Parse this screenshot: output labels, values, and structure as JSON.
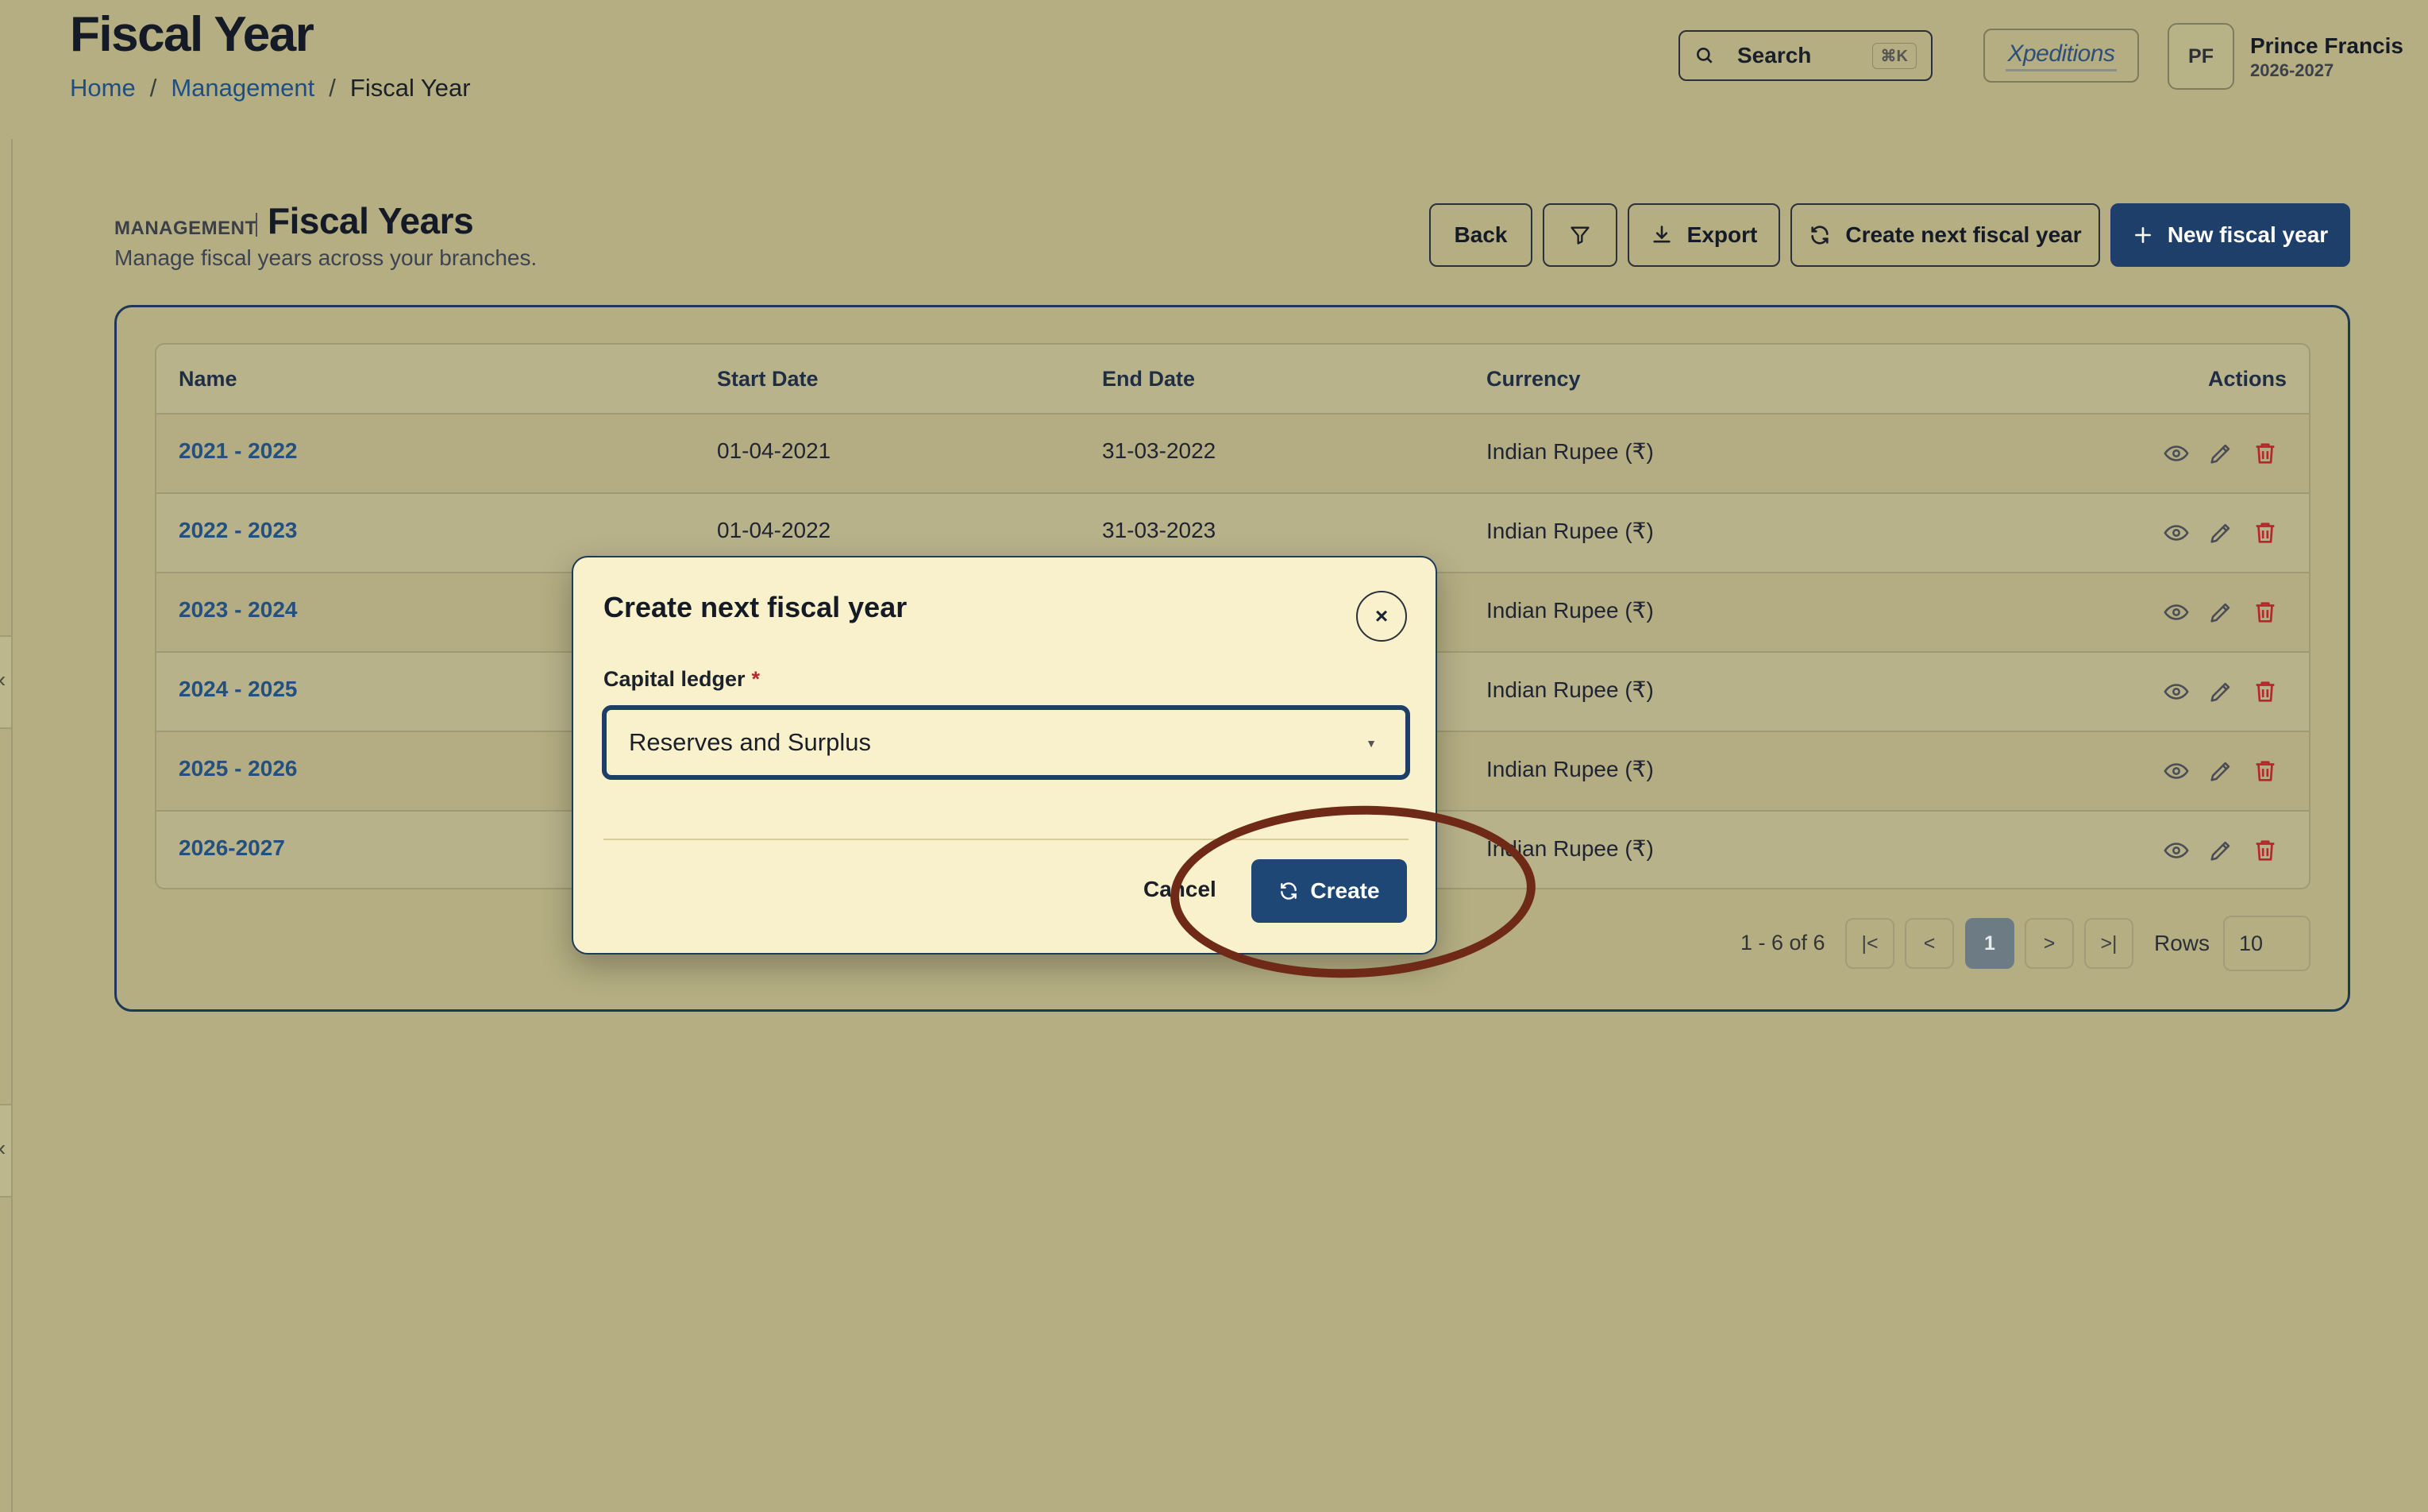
{
  "header": {
    "title": "Fiscal Year",
    "breadcrumb": [
      "Home",
      "Management",
      "Fiscal Year"
    ],
    "breadcrumb_sep": "/",
    "search_label": "Search",
    "search_shortcut": "⌘K",
    "logo_text": "Xpeditions",
    "user": {
      "initials": "PF",
      "name": "Prince Francis",
      "year": "2026-2027"
    }
  },
  "section": {
    "kicker": "MANAGEMENT",
    "title": "Fiscal Years",
    "subtitle": "Manage fiscal years across your branches."
  },
  "toolbar": {
    "back": "Back",
    "filter_icon": "filter-icon",
    "export": "Export",
    "create_next": "Create next fiscal year",
    "new": "New fiscal year"
  },
  "table": {
    "columns": [
      "Name",
      "Start Date",
      "End Date",
      "Currency",
      "Actions"
    ],
    "rows": [
      {
        "name": "2021 - 2022",
        "start": "01-04-2021",
        "end": "31-03-2022",
        "currency": "Indian Rupee (₹)"
      },
      {
        "name": "2022 - 2023",
        "start": "01-04-2022",
        "end": "31-03-2023",
        "currency": "Indian Rupee (₹)"
      },
      {
        "name": "2023 - 2024",
        "start": "",
        "end": "",
        "currency": "Indian Rupee (₹)"
      },
      {
        "name": "2024 - 2025",
        "start": "",
        "end": "",
        "currency": "Indian Rupee (₹)"
      },
      {
        "name": "2025 - 2026",
        "start": "",
        "end": "",
        "currency": "Indian Rupee (₹)"
      },
      {
        "name": "2026-2027",
        "start": "",
        "end": "",
        "currency": "Indian Rupee (₹)"
      }
    ]
  },
  "pagination": {
    "summary": "1 - 6 of 6",
    "first": "|<",
    "prev": "<",
    "current": "1",
    "next": ">",
    "last": ">|",
    "rows_label": "Rows",
    "rows_value": "10"
  },
  "modal": {
    "title": "Create next fiscal year",
    "close": "×",
    "field_label": "Capital ledger",
    "required_mark": "*",
    "field_value": "Reserves and Surplus",
    "cancel": "Cancel",
    "create": "Create"
  },
  "colors": {
    "background": "#b4ae82",
    "primary": "#1f3f6b",
    "link": "#23507f",
    "danger": "#b8262c",
    "modal_bg": "#f8f1cb",
    "highlight": "#6e2a16"
  }
}
